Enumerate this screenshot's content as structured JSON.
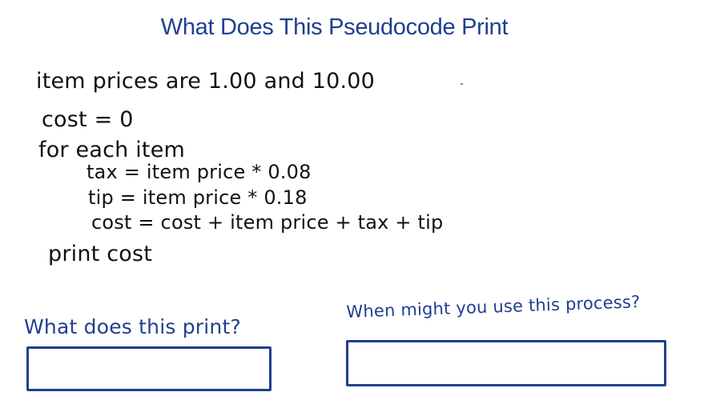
{
  "title": "What Does This Pseudocode Print",
  "code_lines": [
    "item prices are 1.00 and 10.00",
    "cost = 0",
    "for each item",
    "tax = item price * 0.08",
    "tip = item price * 0.18",
    "cost = cost + item price + tax + tip",
    "print cost"
  ],
  "questions": [
    {
      "label": "What does this print?",
      "answer": ""
    },
    {
      "label": "When might you use this process?",
      "answer": ""
    }
  ]
}
